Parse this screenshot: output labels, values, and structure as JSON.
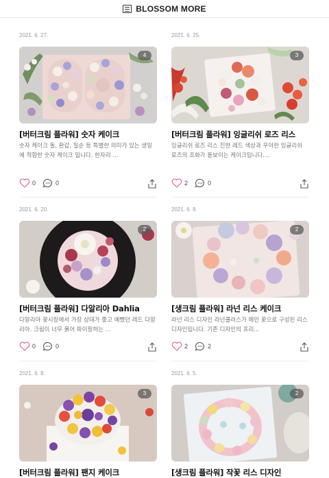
{
  "header": {
    "title": "BLOSSOM MORE",
    "icon": "list-icon"
  },
  "posts": [
    {
      "date": "2021. 6. 27.",
      "badge": "4",
      "title": "[버터크림 플라워] 숫자 케이크",
      "excerpt": "숫자 케이크 돌, 환갑, 칠순 등 특별한 의미가 있는 생일에 적합한 숫자 케이크 입니다. 한자리 ...",
      "likes": "0",
      "comments": "0"
    },
    {
      "date": "2021. 6. 25.",
      "badge": "3",
      "title": "[버터크림 플라워] 잉글리쉬 로즈 리스",
      "excerpt": "잉글리쉬 로즈 리스 진한 레드 색상과 우아한 잉글리쉬 로즈의 조화가 돋보이는 케이크입니다....",
      "likes": "2",
      "comments": "0"
    },
    {
      "date": "2021. 6. 20.",
      "badge": "2",
      "title": "[버터크림 플라워] 다알리아 Dahlia",
      "excerpt": "다알리아 꽃시장에서 가장 상태가 좋고 예뻤던 레드 다알리아. 크림이 너무 묽어 파이핑하는 ...",
      "likes": "0",
      "comments": "0"
    },
    {
      "date": "2021. 6. 8.",
      "badge": "2",
      "title": "[생크림 플라워] 라넌 리스 케이크",
      "excerpt": "라넌 리스 디자인 라넌큘러스가 메인 꽃으로 구성된 리스 디자인입니다. 기존 디자인의 프리...",
      "likes": "2",
      "comments": "2"
    },
    {
      "date": "2021. 6. 8.",
      "badge": "3",
      "title": "[버터크림 플라워] 팬지 케이크"
    },
    {
      "date": "2021. 6. 5.",
      "badge": "2",
      "title": "[생크림 플라워] 작꽃 리스 디자인"
    }
  ],
  "colors": {
    "heart": "#e46b8c",
    "date": "#9a9a9a",
    "excerpt": "#777777"
  }
}
